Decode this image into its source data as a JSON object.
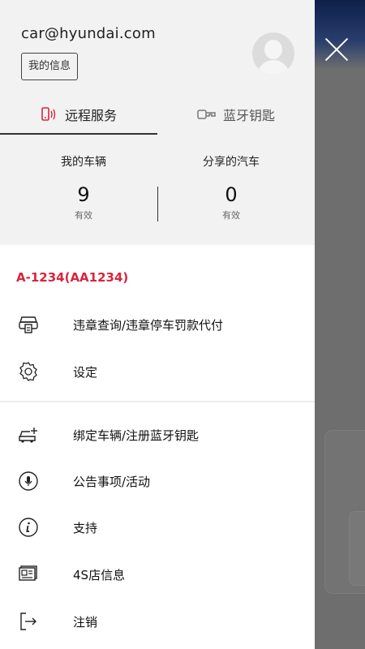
{
  "user": {
    "email": "car@hyundai.com",
    "my_info": "我的信息"
  },
  "tabs": [
    {
      "label": "远程服务",
      "icon": "remote-phone-icon",
      "active": true
    },
    {
      "label": "蓝牙钥匙",
      "icon": "bluetooth-key-icon",
      "active": false
    }
  ],
  "stats": {
    "my_vehicles": {
      "title": "我的车辆",
      "count": "9",
      "status": "有效"
    },
    "shared_cars": {
      "title": "分享的汽车",
      "count": "0",
      "status": "有效"
    }
  },
  "vehicle_plate": "A-1234(AA1234)",
  "menu": {
    "violation": "违章查询/违章停车罚款代付",
    "settings": "设定",
    "bind_vehicle": "绑定车辆/注册蓝牙钥匙",
    "announcements": "公告事项/活动",
    "support": "支持",
    "dealer": "4S店信息",
    "logout": "注销"
  },
  "colors": {
    "accent_red": "#d8253d",
    "header_bg": "#f2f2f2"
  }
}
